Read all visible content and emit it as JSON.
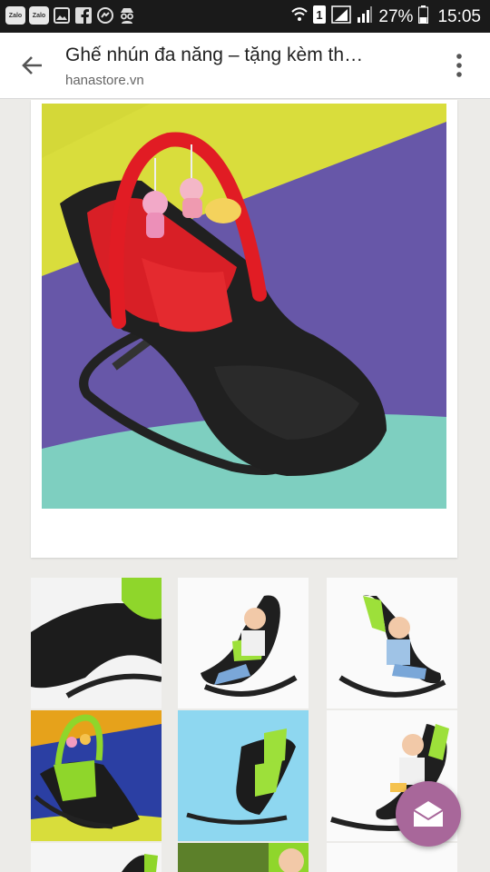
{
  "status_bar": {
    "zalo_label": "Zalo",
    "battery": "27%",
    "time": "15:05",
    "icons": [
      "zalo-icon",
      "zalo-icon",
      "image-icon",
      "facebook-icon",
      "messenger-icon",
      "spy-icon",
      "wifi-icon",
      "sim-1-icon",
      "signal-icon",
      "signal-icon",
      "battery-icon"
    ]
  },
  "app_bar": {
    "title": "Ghế nhún đa năng – tặng kèm th…",
    "url": "hanastore.vn"
  },
  "colors": {
    "accent": "#a8679a",
    "red": "#e01b24",
    "green": "#8fd62b"
  }
}
